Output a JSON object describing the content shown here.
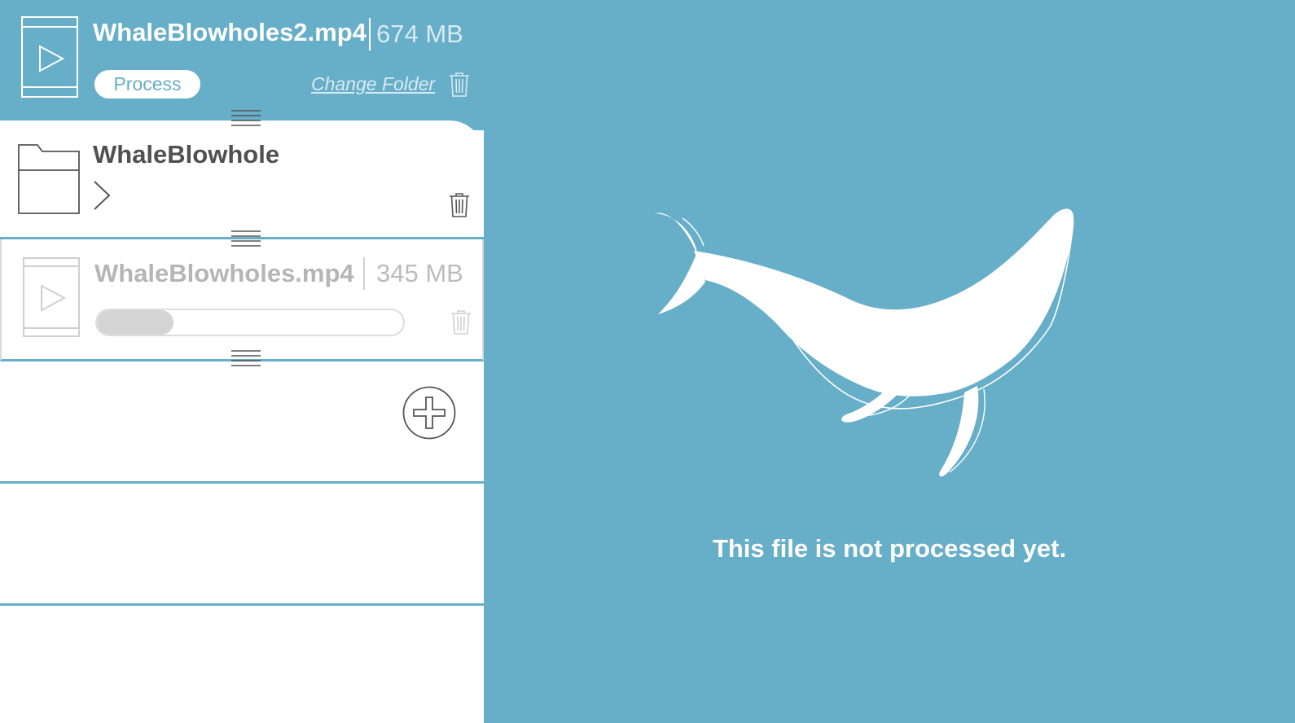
{
  "active_file": {
    "name": "WhaleBlowholes2.mp4",
    "size": "674 MB",
    "process_label": "Process",
    "change_folder_label": "Change Folder"
  },
  "folder": {
    "name": "WhaleBlowhole"
  },
  "queued_file": {
    "name": "WhaleBlowholes.mp4",
    "size": "345 MB",
    "progress": 0.25
  },
  "preview": {
    "status_text": "This file is not processed yet."
  },
  "colors": {
    "accent": "#67aec8",
    "white": "#ffffff",
    "muted": "#b5b5b5"
  },
  "icons": {
    "play": "play-icon",
    "trash": "trash-icon",
    "folder": "folder-icon",
    "chevron": "chevron-right-icon",
    "drag": "drag-handle-icon",
    "add": "plus-circle-icon",
    "whale": "whale-illustration"
  }
}
